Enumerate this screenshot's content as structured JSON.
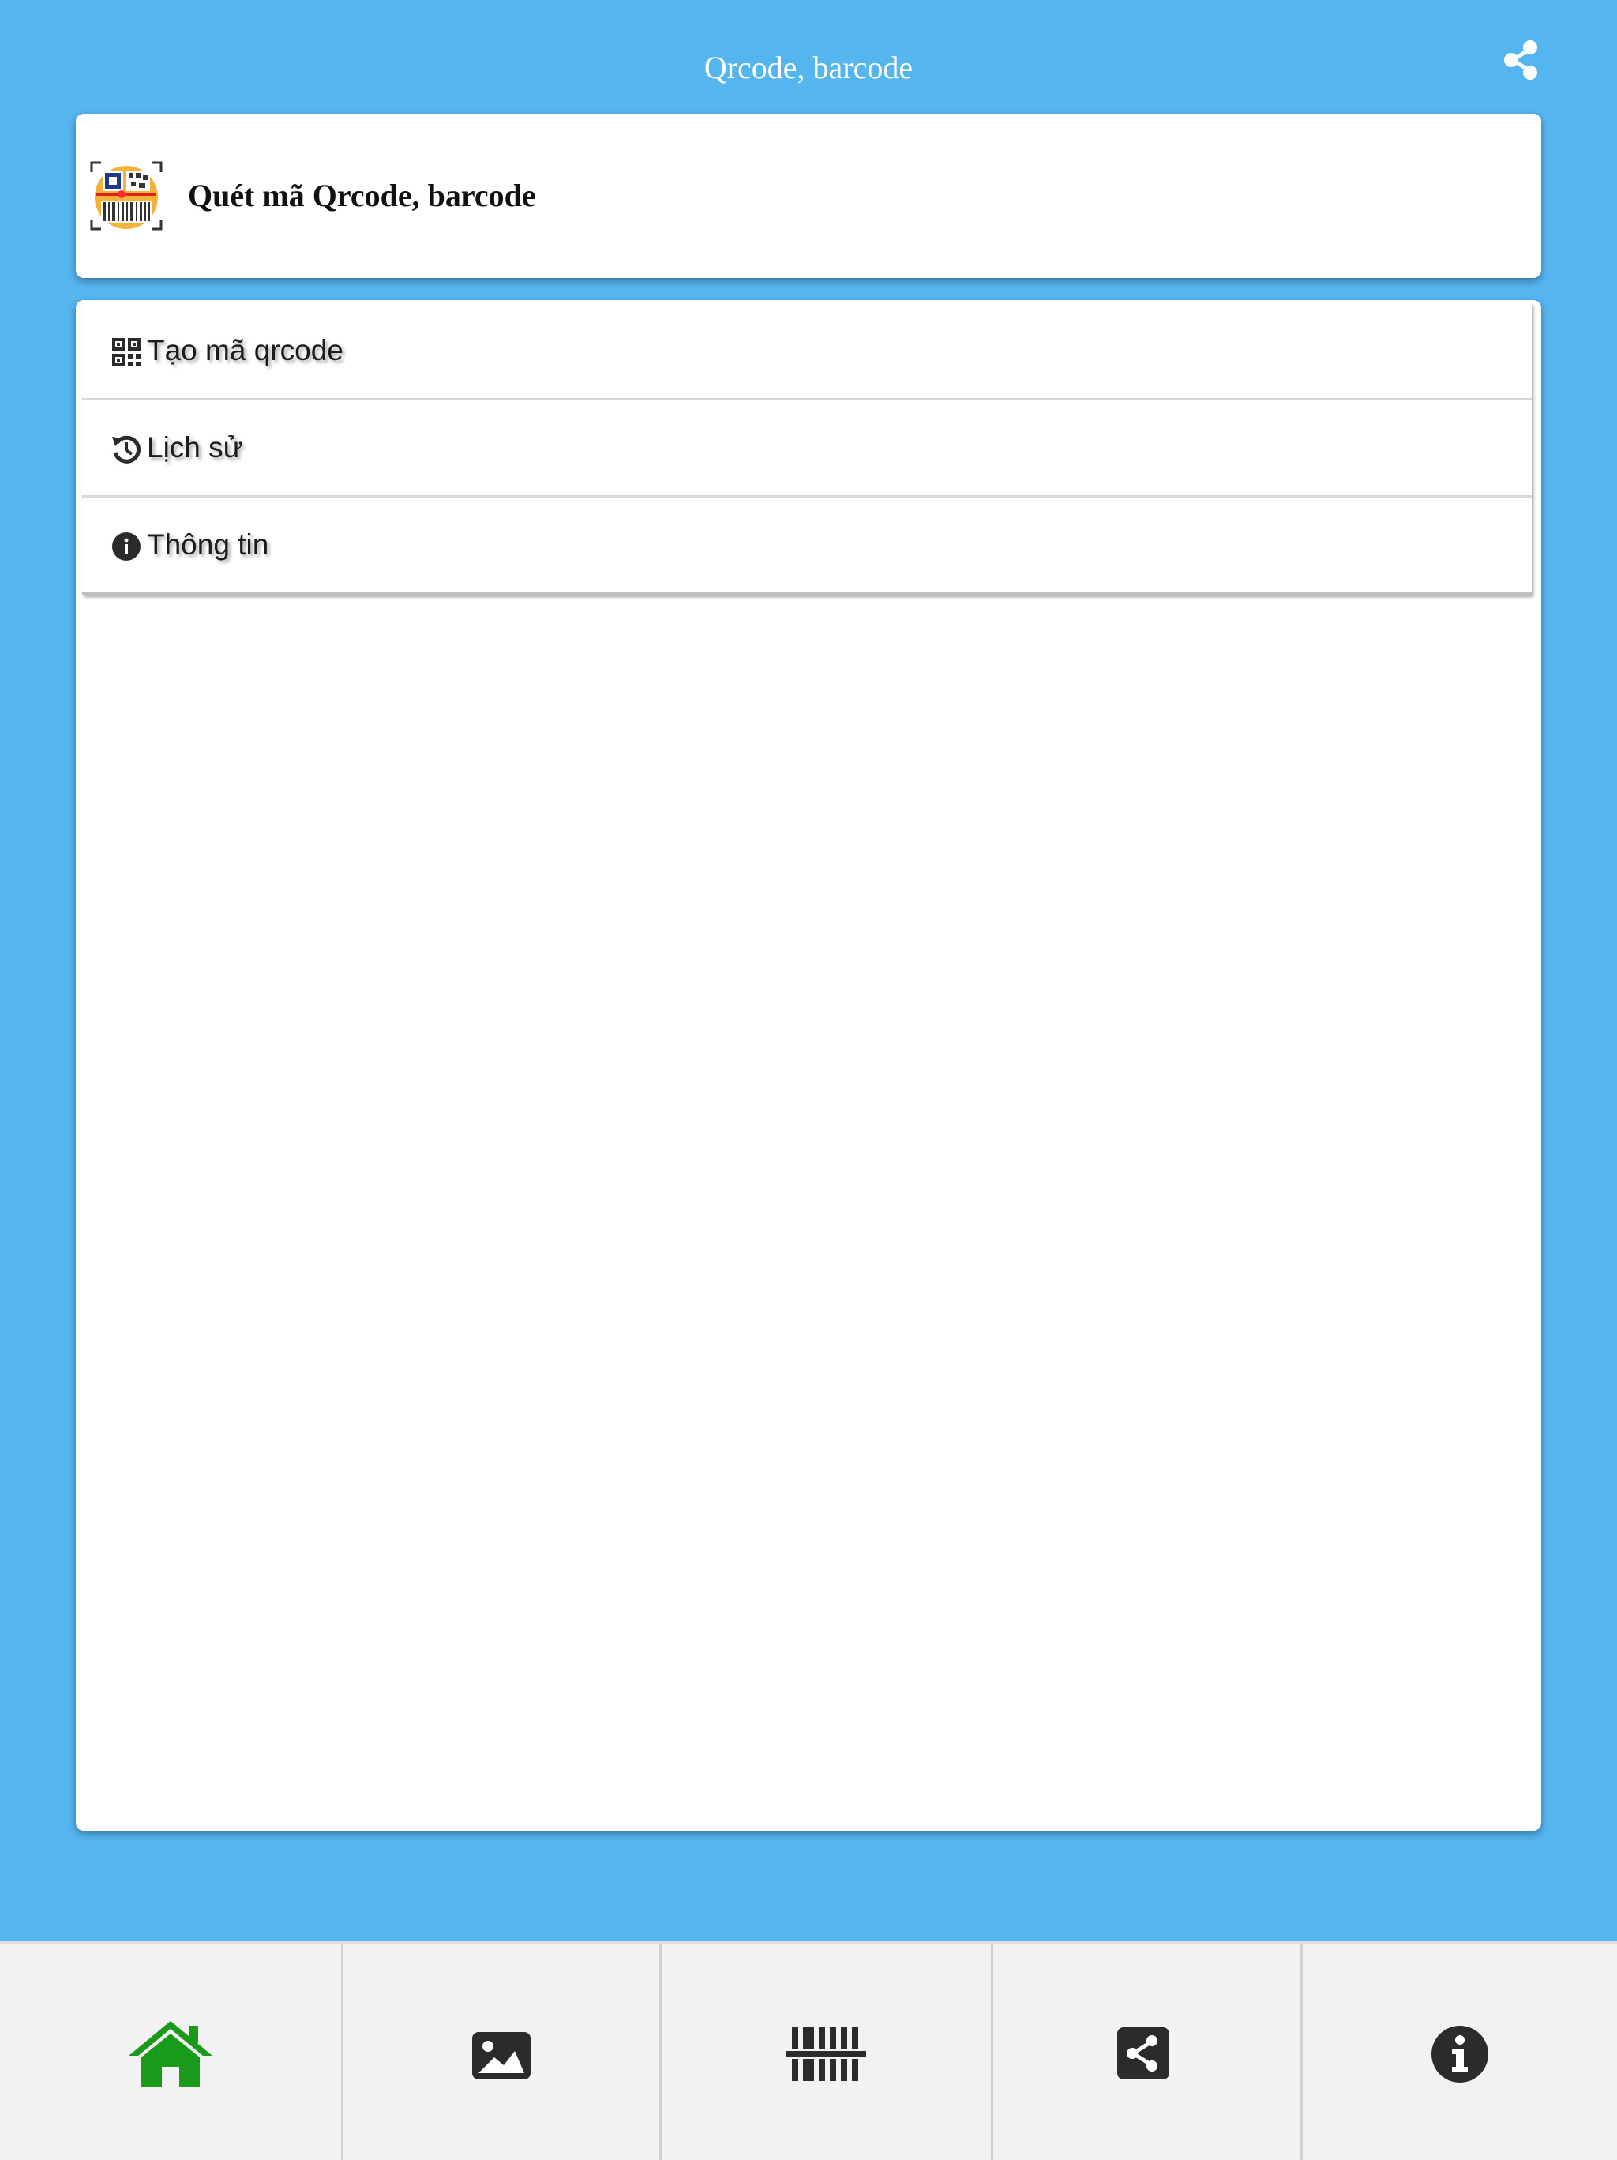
{
  "header": {
    "title": "Qrcode, barcode"
  },
  "app": {
    "name": "Quét mã Qrcode, barcode"
  },
  "menu": {
    "items": [
      {
        "label": "Tạo mã qrcode"
      },
      {
        "label": "Lịch sử"
      },
      {
        "label": "Thông tin"
      }
    ]
  },
  "colors": {
    "background": "#55b5ef",
    "home_active": "#1a9a1a",
    "icon_dark": "#2b2b2b"
  },
  "bottom_nav": {
    "items": [
      {
        "icon": "home-icon",
        "active": true
      },
      {
        "icon": "image-icon"
      },
      {
        "icon": "barcode-scan-icon"
      },
      {
        "icon": "share-icon"
      },
      {
        "icon": "info-icon"
      }
    ]
  }
}
